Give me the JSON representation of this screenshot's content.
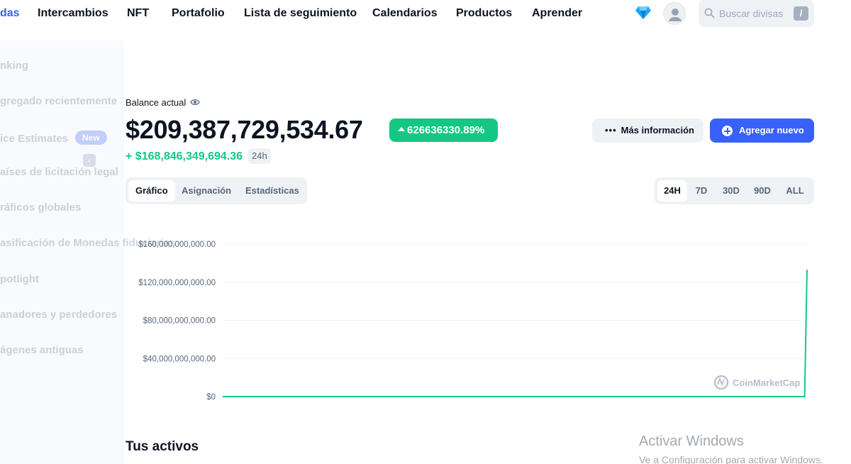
{
  "nav": {
    "items": [
      {
        "label": "das",
        "active": true
      },
      {
        "label": "Intercambios"
      },
      {
        "label": "NFT"
      },
      {
        "label": "Portafolio"
      },
      {
        "label": "Lista de seguimiento"
      },
      {
        "label": "Calendarios"
      },
      {
        "label": "Productos"
      },
      {
        "label": "Aprender"
      }
    ],
    "diamond_icon": "diamond-icon",
    "search_placeholder": "Buscar divisas",
    "search_shortcut": "/"
  },
  "sidebar": {
    "items": [
      {
        "label": "nking"
      },
      {
        "label": "gregado recientemente"
      },
      {
        "label": "ice Estimates",
        "badge": "New"
      },
      {
        "label": "aíses de licitación legal"
      },
      {
        "label": "ráficos globales"
      },
      {
        "label": "asificación de Monedas fiduciarias"
      },
      {
        "label": "potlight"
      },
      {
        "label": "anadores y perdedores"
      },
      {
        "label": "ágenes antiguas"
      }
    ]
  },
  "portfolio": {
    "balance_label": "Balance actual",
    "balance_value": "$209,387,729,534.67",
    "change_percent": "626636330.89%",
    "pnl_value": "+ $168,846,349,694.36",
    "pnl_period": "24h",
    "more_info_label": "Más información",
    "add_new_label": "Agregar nuevo",
    "tabs": [
      {
        "label": "Gráfico",
        "active": true
      },
      {
        "label": "Asignación"
      },
      {
        "label": "Estadísticas"
      }
    ],
    "ranges": [
      {
        "label": "24H",
        "active": true
      },
      {
        "label": "7D"
      },
      {
        "label": "30D"
      },
      {
        "label": "90D"
      },
      {
        "label": "ALL"
      }
    ],
    "assets_title": "Tus activos"
  },
  "chart_data": {
    "type": "line",
    "y_ticks": [
      "$160,000,000,000.00",
      "$120,000,000,000.00",
      "$80,000,000,000.00",
      "$40,000,000,000.00",
      "$0"
    ],
    "ylim": [
      0,
      160000000000
    ],
    "x": [
      0,
      1,
      2,
      3,
      4,
      5,
      6,
      7,
      8,
      9,
      10,
      11,
      12,
      13,
      14,
      15,
      16,
      17,
      18,
      19,
      20,
      21,
      22,
      23,
      23.9,
      24
    ],
    "values": [
      0,
      0,
      0,
      0,
      0,
      0,
      0,
      0,
      0,
      0,
      0,
      0,
      0,
      0,
      0,
      0,
      0,
      0,
      0,
      0,
      0,
      0,
      0,
      0,
      0,
      133000000000
    ],
    "series_color": "#16c784",
    "watermark": "CoinMarketCap",
    "grid": true
  },
  "os_watermark": {
    "line1": "Activar Windows",
    "line2": "Ve a Configuración para activar Windows."
  }
}
